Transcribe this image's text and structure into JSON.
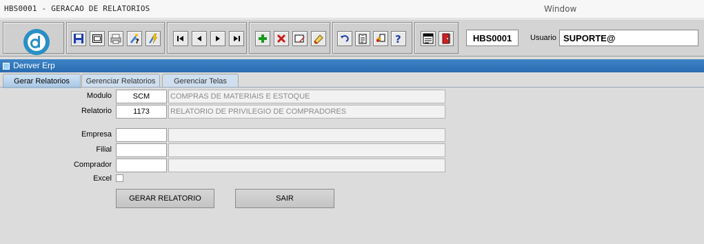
{
  "window": {
    "title": "HBS0001 - GERACAO DE RELATORIOS",
    "menu_window": "Window"
  },
  "toolbar": {
    "logo_letter": "d",
    "form_code": "HBS0001",
    "user_label": "Usuario",
    "user_value": "SUPORTE@",
    "icons": [
      "save-icon",
      "window-icon",
      "print-icon",
      "query-icon",
      "execute-query-icon",
      "first-record-icon",
      "previous-record-icon",
      "next-record-icon",
      "last-record-icon",
      "insert-record-icon",
      "delete-record-icon",
      "edit-icon",
      "clear-icon",
      "undo-icon",
      "list-icon",
      "key-icon",
      "help-icon",
      "menu-icon",
      "exit-icon"
    ]
  },
  "app": {
    "title": "Denver Erp"
  },
  "tabs": [
    {
      "label": "Gerar Relatorios",
      "active": true
    },
    {
      "label": "Gerenciar Relatorios",
      "active": false
    },
    {
      "label": "Gerenciar Telas",
      "active": false
    }
  ],
  "form": {
    "modulo_label": "Modulo",
    "modulo_code": "SCM",
    "modulo_desc": "COMPRAS DE MATERIAIS E ESTOQUE",
    "relatorio_label": "Relatorio",
    "relatorio_code": "1173",
    "relatorio_desc": "RELATORIO DE PRIVILEGIO DE COMPRADORES",
    "empresa_label": "Empresa",
    "empresa_code": "",
    "empresa_desc": "",
    "filial_label": "Filial",
    "filial_code": "",
    "filial_desc": "",
    "comprador_label": "Comprador",
    "comprador_code": "",
    "comprador_desc": "",
    "excel_label": "Excel",
    "excel_checked": false
  },
  "buttons": {
    "generate": "GERAR RELATORIO",
    "exit": "SAIR"
  },
  "colors": {
    "header_blue": "#2a6bb0",
    "tab_active": "#a6c6e6",
    "logo_blue": "#2a8fc4"
  }
}
